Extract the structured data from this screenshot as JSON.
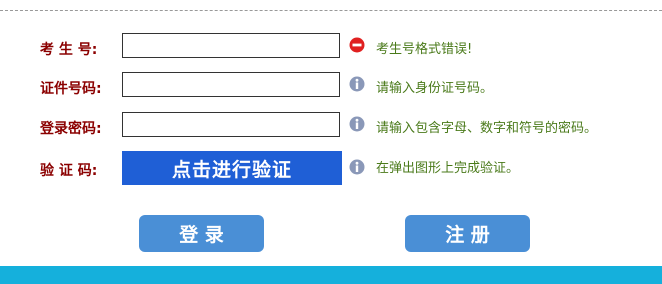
{
  "form": {
    "exam_id": {
      "label": "考 生 号:",
      "value": "",
      "hint": "考生号格式错误!",
      "hint_icon": "error-icon"
    },
    "id_number": {
      "label": "证件号码:",
      "value": "",
      "hint": "请输入身份证号码。",
      "hint_icon": "info-icon"
    },
    "password": {
      "label": "登录密码:",
      "value": "",
      "hint": "请输入包含字母、数字和符号的密码。",
      "hint_icon": "info-icon"
    },
    "captcha": {
      "label": "验 证 码:",
      "button_label": "点击进行验证",
      "hint": "在弹出图形上完成验证。",
      "hint_icon": "info-icon"
    }
  },
  "actions": {
    "login_label": "登 录",
    "register_label": "注 册"
  },
  "colors": {
    "label": "#8b0000",
    "hint": "#4a7a1a",
    "captcha_button": "#1f5fd6",
    "action_button": "#4a8fd6",
    "footer_bar": "#15b0dc",
    "error_icon": "#e02020",
    "info_icon": "#8a98b8"
  }
}
